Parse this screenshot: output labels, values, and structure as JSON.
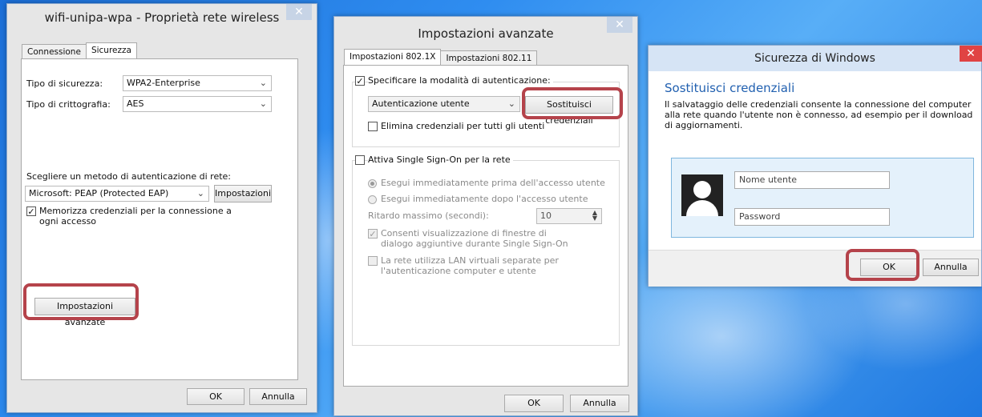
{
  "win1": {
    "title": "wifi-unipa-wpa - Proprietà rete wireless",
    "close": "✕",
    "tabs": [
      "Connessione",
      "Sicurezza"
    ],
    "security_type_label": "Tipo di sicurezza:",
    "security_type_value": "WPA2-Enterprise",
    "encryption_label": "Tipo di crittografia:",
    "encryption_value": "AES",
    "auth_method_label": "Scegliere un metodo di autenticazione di rete:",
    "auth_method_value": "Microsoft: PEAP (Protected EAP)",
    "settings_button": "Impostazioni",
    "remember_label": "Memorizza credenziali per la connessione a ogni accesso",
    "remember_checked": true,
    "advanced_button": "Impostazioni avanzate",
    "ok": "OK",
    "cancel": "Annulla"
  },
  "win2": {
    "title": "Impostazioni avanzate",
    "close": "✕",
    "tabs": [
      "Impostazioni 802.1X",
      "Impostazioni 802.11"
    ],
    "specify_auth_label": "Specificare la modalità di autenticazione:",
    "auth_mode_value": "Autenticazione utente",
    "replace_credentials_button": "Sostituisci credenziali",
    "delete_credentials_label": "Elimina credenziali per tutti gli utenti",
    "sso_label": "Attiva Single Sign-On per la rete",
    "before_logon": "Esegui immediatamente prima dell'accesso utente",
    "after_logon": "Esegui immediatamente dopo l'accesso utente",
    "max_delay_label": "Ritardo massimo (secondi):",
    "max_delay_value": "10",
    "allow_dialogs": "Consenti visualizzazione di finestre di dialogo aggiuntive durante Single Sign-On",
    "vlan_label": "La rete utilizza LAN virtuali separate per l'autenticazione computer e utente",
    "ok": "OK",
    "cancel": "Annulla"
  },
  "win3": {
    "title": "Sicurezza di Windows",
    "close": "✕",
    "heading": "Sostituisci credenziali",
    "description": "Il salvataggio delle credenziali consente la connessione del computer alla rete quando l'utente non è connesso, ad esempio per il download di aggiornamenti.",
    "username_placeholder": "Nome utente",
    "password_placeholder": "Password",
    "ok": "OK",
    "cancel": "Annulla"
  },
  "colors": {
    "highlight": "#b5434b",
    "heading_blue": "#2160b0",
    "close_red": "#e04343"
  }
}
